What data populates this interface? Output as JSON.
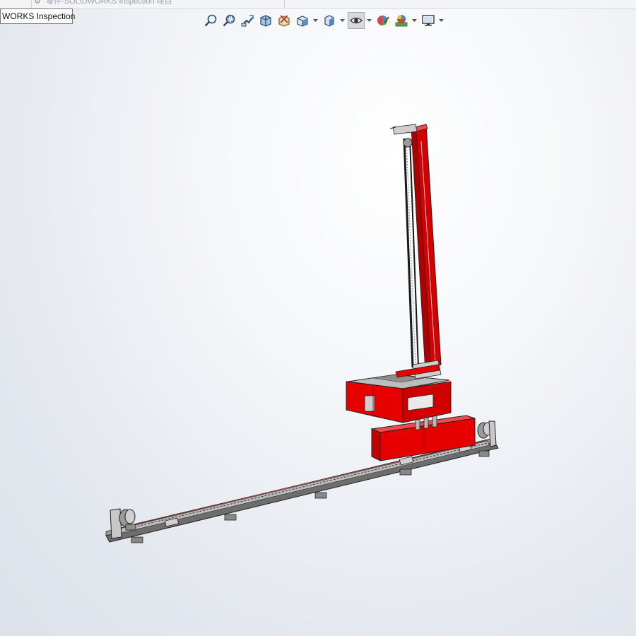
{
  "window": {
    "ghost_title": "零件-SOLIDWORKS Inspection 项目",
    "ghost_icon": "gear-icon"
  },
  "tooltip": {
    "text": "WORKS Inspection"
  },
  "heads_up_toolbar": {
    "buttons": [
      {
        "name": "zoom-to-fit-icon"
      },
      {
        "name": "zoom-to-area-icon"
      },
      {
        "name": "previous-view-icon"
      },
      {
        "name": "section-view-icon"
      },
      {
        "name": "dynamic-annotation-views-icon"
      },
      {
        "name": "view-orientation-icon"
      },
      {
        "name": "display-style-icon"
      },
      {
        "name": "hide-show-items-icon",
        "active": true
      },
      {
        "name": "edit-appearance-icon"
      },
      {
        "name": "apply-scene-icon"
      },
      {
        "name": "view-settings-icon"
      }
    ]
  },
  "model": {
    "description_color_frame": "#e60000",
    "rail_color": "#5a5a5a"
  }
}
